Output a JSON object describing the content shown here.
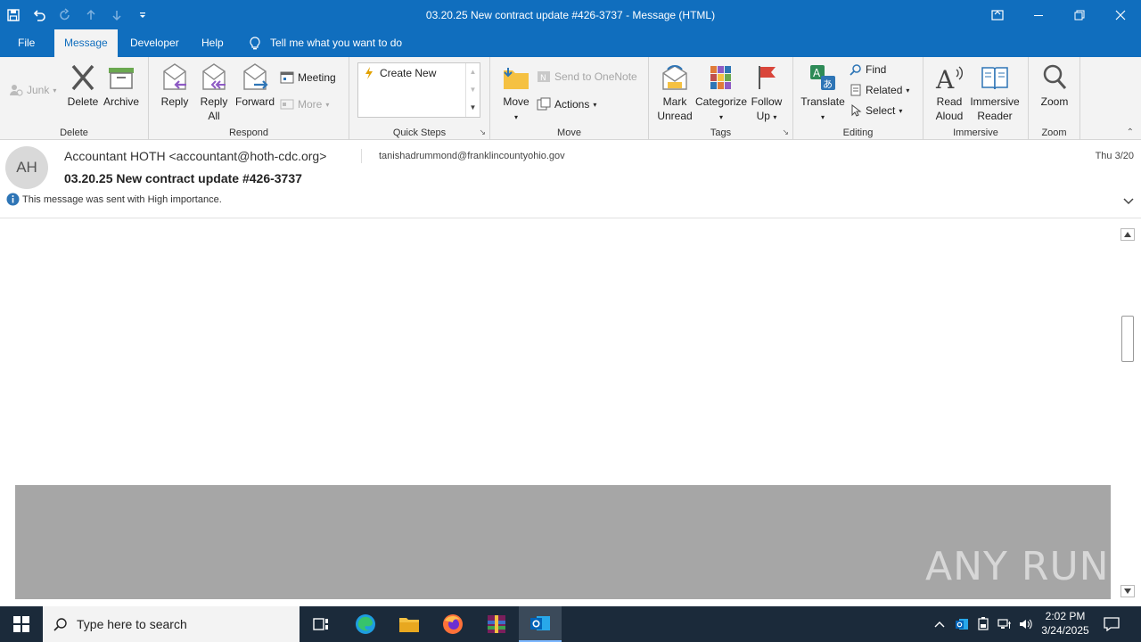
{
  "window": {
    "title": "03.20.25 New contract update #426-3737  -  Message (HTML)"
  },
  "tabs": [
    {
      "label": "File"
    },
    {
      "label": "Message"
    },
    {
      "label": "Developer"
    },
    {
      "label": "Help"
    }
  ],
  "tell_me": "Tell me what you want to do",
  "ribbon": {
    "delete_group": {
      "label": "Delete",
      "junk": "Junk",
      "delete": "Delete",
      "archive": "Archive"
    },
    "respond_group": {
      "label": "Respond",
      "reply": "Reply",
      "reply_all_1": "Reply",
      "reply_all_2": "All",
      "forward": "Forward",
      "meeting": "Meeting",
      "more": "More"
    },
    "quicksteps_group": {
      "label": "Quick Steps",
      "create_new": "Create New"
    },
    "move_group": {
      "label": "Move",
      "move": "Move",
      "send_onenote": "Send to OneNote",
      "actions": "Actions"
    },
    "tags_group": {
      "label": "Tags",
      "mark_1": "Mark",
      "mark_2": "Unread",
      "categorize": "Categorize",
      "follow_1": "Follow",
      "follow_2": "Up"
    },
    "editing_group": {
      "label": "Editing",
      "translate": "Translate",
      "find": "Find",
      "related": "Related",
      "select": "Select"
    },
    "immersive_group": {
      "label": "Immersive",
      "read_1": "Read",
      "read_2": "Aloud",
      "imm_1": "Immersive",
      "imm_2": "Reader"
    },
    "zoom_group": {
      "label": "Zoom",
      "zoom": "Zoom"
    }
  },
  "message": {
    "avatar_initials": "AH",
    "from": "Accountant HOTH <accountant@hoth-cdc.org>",
    "to": "tanishadrummond@franklincountyohio.gov",
    "date": "Thu 3/20",
    "subject": "03.20.25 New contract update #426-3737",
    "importance": "This message was sent with High importance."
  },
  "watermark": "ANY RUN",
  "taskbar": {
    "search_placeholder": "Type here to search",
    "time": "2:02 PM",
    "date": "3/24/2025"
  },
  "colors": {
    "accent": "#106ebe",
    "taskbar": "#1b2a3a",
    "ribbon_bg": "#f3f3f3"
  }
}
